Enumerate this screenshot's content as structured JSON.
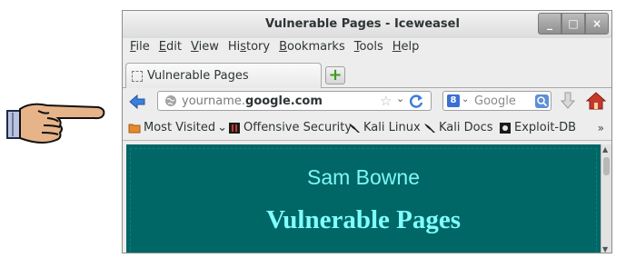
{
  "window": {
    "title": "Vulnerable Pages - Iceweasel",
    "buttons": {
      "minimize": "_",
      "maximize": "□",
      "close": "×"
    }
  },
  "menubar": [
    {
      "label": "File",
      "mnemonic": "F",
      "rest": "ile"
    },
    {
      "label": "Edit",
      "mnemonic": "E",
      "rest": "dit"
    },
    {
      "label": "View",
      "mnemonic": "V",
      "rest": "iew"
    },
    {
      "label": "History",
      "mnemonic_prefix": "Hi",
      "mnemonic": "s",
      "rest": "tory"
    },
    {
      "label": "Bookmarks",
      "mnemonic": "B",
      "rest": "ookmarks"
    },
    {
      "label": "Tools",
      "mnemonic": "T",
      "rest": "ools"
    },
    {
      "label": "Help",
      "mnemonic": "H",
      "rest": "elp"
    }
  ],
  "tabs": [
    {
      "label": "Vulnerable Pages",
      "active": true
    }
  ],
  "newtab_label": "+",
  "urlbar": {
    "prefix": "yourname.",
    "domain": "google.com",
    "star": "☆",
    "dropdown": "⌄"
  },
  "search": {
    "engine_badge": "8",
    "dropdown": "⌄",
    "placeholder": "Google"
  },
  "bookmarks": [
    {
      "label": "Most Visited",
      "suffix": "⌄",
      "icon": "folder-icon"
    },
    {
      "label": "Offensive Security",
      "icon": "offsec-icon"
    },
    {
      "label": "Kali Linux",
      "icon": "kali-dragon-icon"
    },
    {
      "label": "Kali Docs",
      "icon": "kali-dragon-icon"
    },
    {
      "label": "Exploit-DB",
      "icon": "exploitdb-icon"
    }
  ],
  "bookmarks_overflow": "»",
  "page": {
    "author": "Sam Bowne",
    "heading": "Vulnerable Pages",
    "background_color": "#006666",
    "text_color": "#80ffff"
  },
  "colors": {
    "accent_back": "#3d7ed9",
    "home_red": "#c8382a",
    "addtab_green": "#3f9b1e"
  }
}
